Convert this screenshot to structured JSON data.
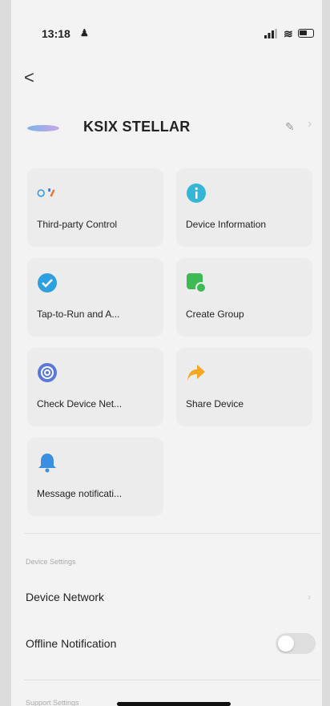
{
  "status_bar": {
    "time": "13:18",
    "person_icon": "person-icon"
  },
  "header": {
    "back_label": "<",
    "device_name": "KSIX STELLAR"
  },
  "tiles": [
    {
      "label": "Third-party Control",
      "icon": "third-party-control-icon"
    },
    {
      "label": "Device Information",
      "icon": "info-icon",
      "color": "#36b6d6"
    },
    {
      "label": "Tap-to-Run and A...",
      "icon": "check-icon",
      "color": "#2ea0e0"
    },
    {
      "label": "Create Group",
      "icon": "group-icon",
      "color": "#3cba54"
    },
    {
      "label": "Check Device Net...",
      "icon": "network-icon",
      "color": "#5a78d8"
    },
    {
      "label": "Share Device",
      "icon": "share-icon",
      "color": "#f5a623"
    },
    {
      "label": "Message notificati...",
      "icon": "bell-icon",
      "color": "#3b8fe0"
    }
  ],
  "settings": {
    "section_title": "Device Settings",
    "network_label": "Device Network",
    "offline_label": "Offline Notification",
    "offline_enabled": false,
    "next_section_title": "Support Settings"
  }
}
